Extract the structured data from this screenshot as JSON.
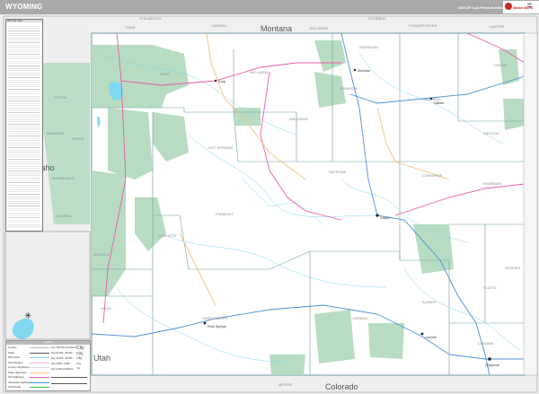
{
  "header": {
    "title": "WYOMING",
    "edition": "2020 ZIP Code Premium Edition",
    "logo": "Market MAPS"
  },
  "states": {
    "montana": "Montana",
    "idaho": "Idaho",
    "utah": "Utah",
    "colorado": "Colorado"
  },
  "wyoming_counties": [
    {
      "name": "PARK"
    },
    {
      "name": "BIG HORN"
    },
    {
      "name": "SHERIDAN"
    },
    {
      "name": "JOHNSON"
    },
    {
      "name": "CAMPBELL"
    },
    {
      "name": "CROOK"
    },
    {
      "name": "WESTON"
    },
    {
      "name": "WASHAKIE"
    },
    {
      "name": "HOT SPRINGS"
    },
    {
      "name": "NATRONA"
    },
    {
      "name": "CONVERSE"
    },
    {
      "name": "NIOBRARA"
    },
    {
      "name": "FREMONT"
    },
    {
      "name": "TETON"
    },
    {
      "name": "LINCOLN"
    },
    {
      "name": "SUBLETTE"
    },
    {
      "name": "SWEETWATER"
    },
    {
      "name": "UINTA"
    },
    {
      "name": "CARBON"
    },
    {
      "name": "ALBANY"
    },
    {
      "name": "PLATTE"
    },
    {
      "name": "GOSHEN"
    },
    {
      "name": "LARAMIE"
    }
  ],
  "neighbor_counties": [
    {
      "name": "STILLWATER"
    },
    {
      "name": "PARK"
    },
    {
      "name": "CARBON"
    },
    {
      "name": "BIG HORN"
    },
    {
      "name": "ROSEBUD"
    },
    {
      "name": "POWDER RIVER"
    },
    {
      "name": "CARTER"
    },
    {
      "name": "MOFFAT"
    },
    {
      "name": "MADISON"
    },
    {
      "name": "TETON"
    },
    {
      "name": "BONNEVILLE"
    },
    {
      "name": "CARIBOU"
    }
  ],
  "cities": [
    "Cody",
    "Sheridan",
    "Gillette",
    "Casper",
    "Rock Springs",
    "Cheyenne",
    "Laramie"
  ],
  "legend": {
    "rows": [
      "County",
      "State",
      "ZIP Code",
      "Fed Ranges",
      "County Highways",
      "State Highways",
      "US Highways",
      "Interstate Highways",
      "Toll Roads"
    ],
    "colors": [
      "#bdbdbd",
      "#555555",
      "#7fd8f0",
      "#f3c0c0",
      "#dddddd",
      "#f5c27a",
      "#e85aa8",
      "#4a90d9",
      "#3cc43c"
    ],
    "pop": [
      {
        "label": "Pop 100,000 and Above",
        "sample": "City"
      },
      {
        "label": "Pop 50,000 - 99,999",
        "sample": "City"
      },
      {
        "label": "Pop 10,000 - 49,999",
        "sample": "City"
      },
      {
        "label": "Pop 2,500 - 9,999",
        "sample": "City"
      },
      {
        "label": "Pop 2,500 and Below",
        "sample": "City"
      }
    ]
  },
  "colors": {
    "forest": "#b7dcc1",
    "water": "#7fd8f0",
    "outside": "#efefef",
    "header": "#a9a9a9",
    "interstate": "#4a90d9",
    "us_hwy": "#e85aa8",
    "state_hwy": "#f5c27a"
  }
}
